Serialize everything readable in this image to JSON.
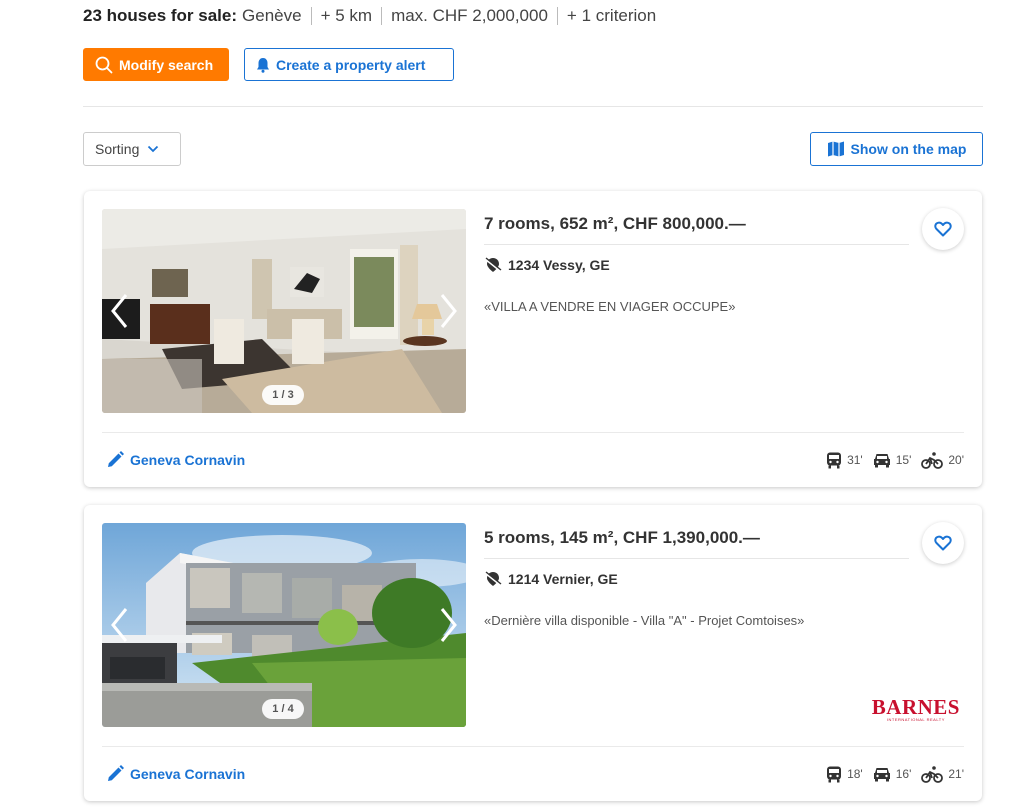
{
  "summary": {
    "count_label": "23 houses for sale:",
    "location": "Genève",
    "radius": "+ 5 km",
    "max_price": "max. CHF 2,000,000",
    "criteria": "+ 1 criterion"
  },
  "actions": {
    "modify_search": "Modify search",
    "create_alert": "Create a property alert"
  },
  "toolbar": {
    "sorting": "Sorting",
    "show_map": "Show on the map"
  },
  "colors": {
    "accent_orange": "#ff7a00",
    "accent_blue": "#1a73d4",
    "agency_red": "#c8102e"
  },
  "listings": [
    {
      "title": "7 rooms, 652 m², CHF 800,000.—",
      "location": "1234 Vessy, GE",
      "description": "«VILLA A VENDRE EN VIAGER OCCUPE»",
      "photo_counter": "1 / 3",
      "station": "Geneva Cornavin",
      "travel": {
        "transit": "31'",
        "car": "15'",
        "bike": "20'"
      },
      "agency": null
    },
    {
      "title": "5 rooms, 145 m², CHF 1,390,000.—",
      "location": "1214 Vernier, GE",
      "description": "«Dernière villa disponible - Villa \"A\" - Projet Comtoises»",
      "photo_counter": "1 / 4",
      "station": "Geneva Cornavin",
      "travel": {
        "transit": "18'",
        "car": "16'",
        "bike": "21'"
      },
      "agency": {
        "name": "BARNES",
        "tagline": "INTERNATIONAL REALTY"
      }
    }
  ]
}
